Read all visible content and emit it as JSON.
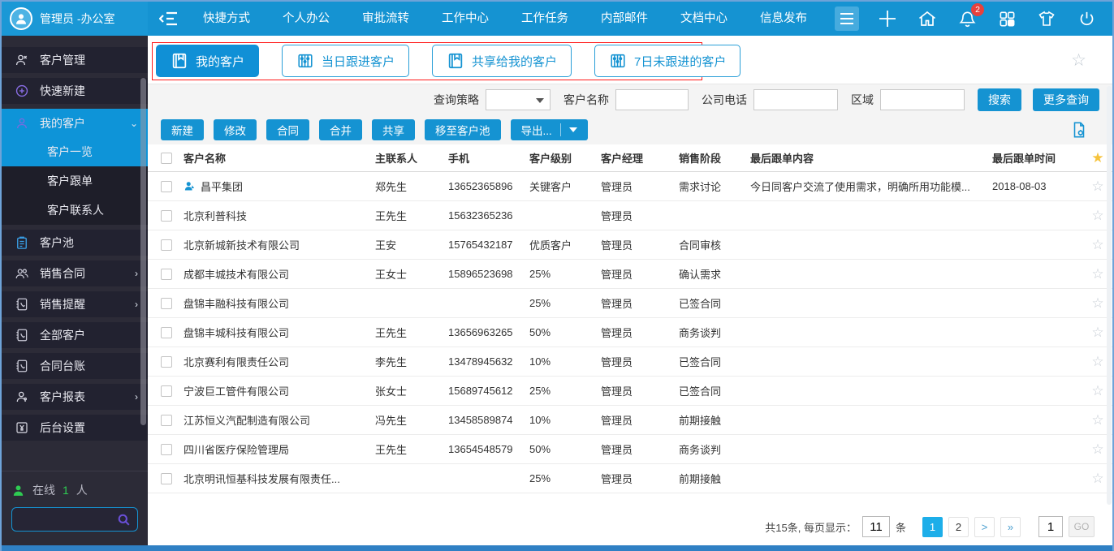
{
  "topbar": {
    "user_name": "管理员 -办公室",
    "nav": [
      "快捷方式",
      "个人办公",
      "审批流转",
      "工作中心",
      "工作任务",
      "内部邮件",
      "文档中心",
      "信息发布"
    ],
    "notification_count": "2"
  },
  "sidebar": {
    "items": [
      {
        "label": "客户管理"
      },
      {
        "label": "快速新建"
      },
      {
        "label": "我的客户"
      },
      {
        "label": "客户一览"
      },
      {
        "label": "客户跟单"
      },
      {
        "label": "客户联系人"
      },
      {
        "label": "客户池"
      },
      {
        "label": "销售合同"
      },
      {
        "label": "销售提醒"
      },
      {
        "label": "全部客户"
      },
      {
        "label": "合同台账"
      },
      {
        "label": "客户报表"
      },
      {
        "label": "后台设置"
      }
    ],
    "online": {
      "label": "在线",
      "count": "1",
      "suffix": "人"
    }
  },
  "tabs": [
    {
      "label": "我的客户"
    },
    {
      "label": "当日跟进客户"
    },
    {
      "label": "共享给我的客户"
    },
    {
      "label": "7日未跟进的客户"
    }
  ],
  "filters": {
    "strategy_label": "查询策略",
    "name_label": "客户名称",
    "phone_label": "公司电话",
    "region_label": "区域",
    "search_button": "搜索",
    "more_button": "更多查询"
  },
  "actions": {
    "buttons": [
      "新建",
      "修改",
      "合同",
      "合并",
      "共享",
      "移至客户池"
    ],
    "export_button": "导出..."
  },
  "table": {
    "headers": {
      "name": "客户名称",
      "contact": "主联系人",
      "phone": "手机",
      "level": "客户级别",
      "manager": "客户经理",
      "stage": "销售阶段",
      "content": "最后跟单内容",
      "time": "最后跟单时间"
    },
    "rows": [
      {
        "name": "昌平集团",
        "has_icon": true,
        "contact": "郑先生",
        "phone": "13652365896",
        "level": "关键客户",
        "manager": "管理员",
        "stage": "需求讨论",
        "last_content": "今日同客户交流了使用需求，明确所用功能模...",
        "last_time": "2018-08-03"
      },
      {
        "name": "北京利普科技",
        "contact": "王先生",
        "phone": "15632365236",
        "level": "",
        "manager": "管理员",
        "stage": "",
        "last_content": "",
        "last_time": ""
      },
      {
        "name": "北京新城新技术有限公司",
        "contact": "王安",
        "phone": "15765432187",
        "level": "优质客户",
        "manager": "管理员",
        "stage": "合同审核",
        "last_content": "",
        "last_time": ""
      },
      {
        "name": "成都丰城技术有限公司",
        "contact": "王女士",
        "phone": "15896523698",
        "level": "25%",
        "manager": "管理员",
        "stage": "确认需求",
        "last_content": "",
        "last_time": ""
      },
      {
        "name": "盘锦丰融科技有限公司",
        "contact": "",
        "phone": "",
        "level": "25%",
        "manager": "管理员",
        "stage": "已签合同",
        "last_content": "",
        "last_time": ""
      },
      {
        "name": "盘锦丰城科技有限公司",
        "contact": "王先生",
        "phone": "13656963265",
        "level": "50%",
        "manager": "管理员",
        "stage": "商务谈判",
        "last_content": "",
        "last_time": ""
      },
      {
        "name": "北京赛利有限责任公司",
        "contact": "李先生",
        "phone": "13478945632",
        "level": "10%",
        "manager": "管理员",
        "stage": "已签合同",
        "last_content": "",
        "last_time": ""
      },
      {
        "name": "宁波巨工管件有限公司",
        "contact": "张女士",
        "phone": "15689745612",
        "level": "25%",
        "manager": "管理员",
        "stage": "已签合同",
        "last_content": "",
        "last_time": ""
      },
      {
        "name": "江苏恒义汽配制造有限公司",
        "contact": "冯先生",
        "phone": "13458589874",
        "level": "10%",
        "manager": "管理员",
        "stage": "前期接触",
        "last_content": "",
        "last_time": ""
      },
      {
        "name": "四川省医疗保险管理局",
        "contact": "王先生",
        "phone": "13654548579",
        "level": "50%",
        "manager": "管理员",
        "stage": "商务谈判",
        "last_content": "",
        "last_time": ""
      },
      {
        "name": "北京明讯恒基科技发展有限责任...",
        "contact": "",
        "phone": "",
        "level": "25%",
        "manager": "管理员",
        "stage": "前期接触",
        "last_content": "",
        "last_time": ""
      }
    ]
  },
  "pagination": {
    "total_label": "共15条, 每页显示：",
    "per_page": "11",
    "unit": "条",
    "page1": "1",
    "page2": "2",
    "next": ">",
    "last": "»",
    "jump": "1",
    "go": "GO"
  },
  "colors": {
    "primary": "#1593d2",
    "badge": "#e8413c",
    "active_page": "#1daee9",
    "star_gold": "#f6c33c"
  }
}
